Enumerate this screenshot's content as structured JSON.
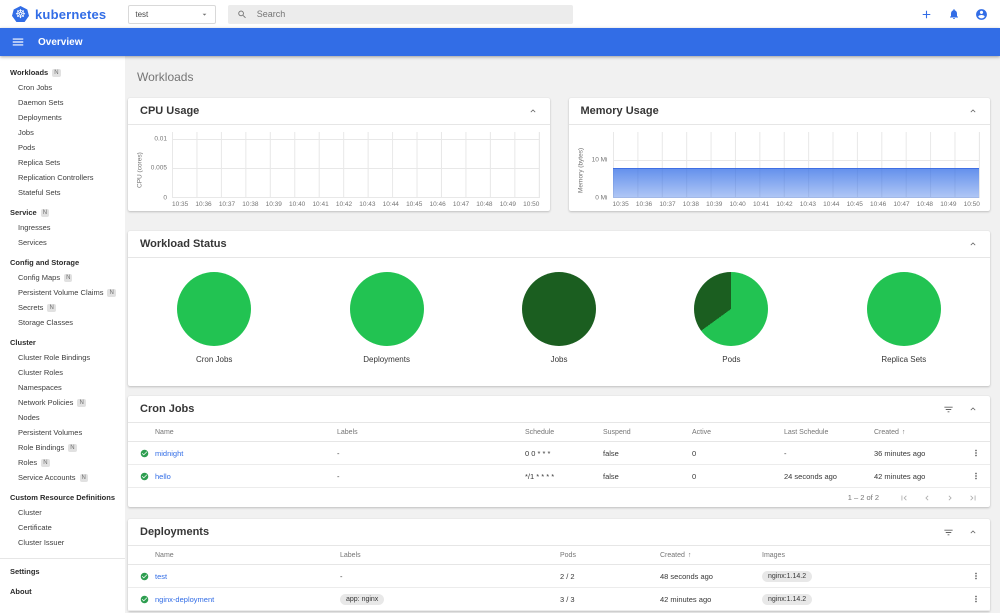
{
  "header": {
    "brand": "kubernetes",
    "namespace": {
      "value": "test"
    },
    "search": {
      "placeholder": "Search"
    }
  },
  "toolbar": {
    "title": "Overview"
  },
  "icons": {
    "logo": "kubernetes-helm-wheel",
    "menu": "hamburger",
    "search": "magnifier",
    "add": "plus",
    "notifications": "bell",
    "account": "person-circle",
    "namespace_caret": "caret-down",
    "filter": "filter-list",
    "collapse": "chevron-up",
    "sort": "arrow-up",
    "row_menu": "kebab-dots",
    "status_ok": "check-circle",
    "pagination": [
      "first-page",
      "chevron-left",
      "chevron-right",
      "last-page"
    ]
  },
  "sidebar": {
    "items": [
      {
        "label": "Workloads",
        "kind": "top",
        "badge": "N"
      },
      {
        "label": "Cron Jobs",
        "kind": "sub"
      },
      {
        "label": "Daemon Sets",
        "kind": "sub"
      },
      {
        "label": "Deployments",
        "kind": "sub"
      },
      {
        "label": "Jobs",
        "kind": "sub"
      },
      {
        "label": "Pods",
        "kind": "sub"
      },
      {
        "label": "Replica Sets",
        "kind": "sub"
      },
      {
        "label": "Replication Controllers",
        "kind": "sub"
      },
      {
        "label": "Stateful Sets",
        "kind": "sub"
      },
      {
        "label": "Service",
        "kind": "top",
        "badge": "N"
      },
      {
        "label": "Ingresses",
        "kind": "sub"
      },
      {
        "label": "Services",
        "kind": "sub"
      },
      {
        "label": "Config and Storage",
        "kind": "top"
      },
      {
        "label": "Config Maps",
        "kind": "sub",
        "badge": "N"
      },
      {
        "label": "Persistent Volume Claims",
        "kind": "sub",
        "badge": "N"
      },
      {
        "label": "Secrets",
        "kind": "sub",
        "badge": "N"
      },
      {
        "label": "Storage Classes",
        "kind": "sub"
      },
      {
        "label": "Cluster",
        "kind": "top"
      },
      {
        "label": "Cluster Role Bindings",
        "kind": "sub"
      },
      {
        "label": "Cluster Roles",
        "kind": "sub"
      },
      {
        "label": "Namespaces",
        "kind": "sub"
      },
      {
        "label": "Network Policies",
        "kind": "sub",
        "badge": "N"
      },
      {
        "label": "Nodes",
        "kind": "sub"
      },
      {
        "label": "Persistent Volumes",
        "kind": "sub"
      },
      {
        "label": "Role Bindings",
        "kind": "sub",
        "badge": "N"
      },
      {
        "label": "Roles",
        "kind": "sub",
        "badge": "N"
      },
      {
        "label": "Service Accounts",
        "kind": "sub",
        "badge": "N"
      },
      {
        "label": "Custom Resource Definitions",
        "kind": "top"
      },
      {
        "label": "Cluster",
        "kind": "sub"
      },
      {
        "label": "Certificate",
        "kind": "sub"
      },
      {
        "label": "Cluster Issuer",
        "kind": "sub"
      }
    ],
    "footer_items": [
      {
        "label": "Settings",
        "kind": "top"
      },
      {
        "label": "About",
        "kind": "top"
      }
    ]
  },
  "page": {
    "title": "Workloads"
  },
  "workload_status": {
    "title": "Workload Status"
  },
  "chart_data": [
    {
      "type": "area",
      "title": "CPU Usage",
      "ylabel": "CPU (cores)",
      "x": [
        "10:35",
        "10:36",
        "10:37",
        "10:38",
        "10:39",
        "10:40",
        "10:41",
        "10:42",
        "10:43",
        "10:44",
        "10:45",
        "10:46",
        "10:47",
        "10:48",
        "10:49",
        "10:50"
      ],
      "yticks": [
        "0.01",
        "0.005",
        "0"
      ],
      "ytick_values": [
        0.01,
        0.005,
        0
      ],
      "ylim": [
        0,
        0.0111
      ],
      "grid": true,
      "series": []
    },
    {
      "type": "area",
      "title": "Memory Usage",
      "ylabel": "Memory (bytes)",
      "x": [
        "10:35",
        "10:36",
        "10:37",
        "10:38",
        "10:39",
        "10:40",
        "10:41",
        "10:42",
        "10:43",
        "10:44",
        "10:45",
        "10:46",
        "10:47",
        "10:48",
        "10:49",
        "10:50"
      ],
      "yticks": [
        "10 Mi",
        "0 Mi"
      ],
      "ytick_values": [
        10,
        0
      ],
      "ylim": [
        0,
        17.5
      ],
      "grid": true,
      "series": [
        {
          "name": "Memory usage",
          "unit": "Mi",
          "values": [
            8,
            8,
            8,
            8,
            8,
            8,
            8,
            8,
            8,
            8,
            8,
            8,
            8,
            8,
            8,
            8
          ]
        }
      ],
      "area_color": "#326de6"
    },
    {
      "type": "pie",
      "title": "Cron Jobs",
      "slices": [
        {
          "value": 100,
          "color": "#22c352"
        }
      ]
    },
    {
      "type": "pie",
      "title": "Deployments",
      "slices": [
        {
          "value": 100,
          "color": "#22c352"
        }
      ]
    },
    {
      "type": "pie",
      "title": "Jobs",
      "slices": [
        {
          "value": 100,
          "color": "#1b5e20"
        }
      ]
    },
    {
      "type": "pie",
      "title": "Pods",
      "slices": [
        {
          "value": 65,
          "color": "#22c352"
        },
        {
          "value": 35,
          "color": "#1b5e20"
        }
      ]
    },
    {
      "type": "pie",
      "title": "Replica Sets",
      "slices": [
        {
          "value": 100,
          "color": "#22c352"
        }
      ]
    }
  ],
  "cron_jobs": {
    "title": "Cron Jobs",
    "columns": [
      "Name",
      "Labels",
      "Schedule",
      "Suspend",
      "Active",
      "Last Schedule",
      "Created"
    ],
    "sorted_by": "Created",
    "rows": [
      {
        "name": "midnight",
        "labels": "-",
        "schedule": "0 0 * * *",
        "suspend": "false",
        "active": "0",
        "last_schedule": "-",
        "created": "36 minutes ago"
      },
      {
        "name": "hello",
        "labels": "-",
        "schedule": "*/1 * * * *",
        "suspend": "false",
        "active": "0",
        "last_schedule": "24 seconds ago",
        "created": "42 minutes ago"
      }
    ],
    "pagination": {
      "range": "1 – 2 of 2"
    }
  },
  "deployments": {
    "title": "Deployments",
    "columns": [
      "Name",
      "Labels",
      "Pods",
      "Created",
      "Images"
    ],
    "sorted_by": "Created",
    "rows": [
      {
        "name": "test",
        "labels_plain": "-",
        "pods": "2 / 2",
        "created": "48 seconds ago",
        "image": "nginx:1.14.2"
      },
      {
        "name": "nginx-deployment",
        "labels_chip": "app: nginx",
        "pods": "3 / 3",
        "created": "42 minutes ago",
        "image": "nginx:1.14.2"
      }
    ]
  },
  "colors": {
    "primary": "#326de6",
    "success_icon": "#2e9e50",
    "pie_green": "#22c352",
    "pie_dark_green": "#1b5e20",
    "background": "#f1f1f1"
  }
}
